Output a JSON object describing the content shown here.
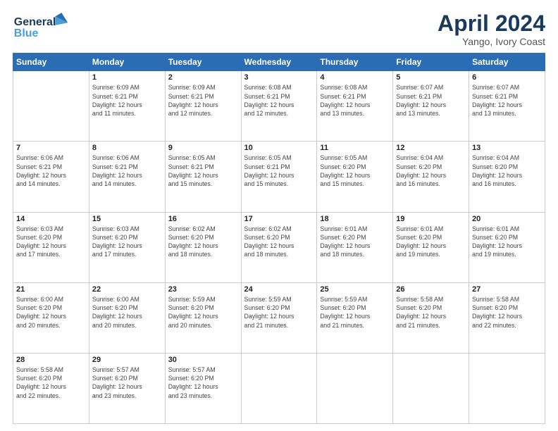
{
  "header": {
    "logo_line1": "General",
    "logo_line2": "Blue",
    "month": "April 2024",
    "location": "Yango, Ivory Coast"
  },
  "weekdays": [
    "Sunday",
    "Monday",
    "Tuesday",
    "Wednesday",
    "Thursday",
    "Friday",
    "Saturday"
  ],
  "weeks": [
    [
      {
        "day": "",
        "info": ""
      },
      {
        "day": "1",
        "info": "Sunrise: 6:09 AM\nSunset: 6:21 PM\nDaylight: 12 hours\nand 11 minutes."
      },
      {
        "day": "2",
        "info": "Sunrise: 6:09 AM\nSunset: 6:21 PM\nDaylight: 12 hours\nand 12 minutes."
      },
      {
        "day": "3",
        "info": "Sunrise: 6:08 AM\nSunset: 6:21 PM\nDaylight: 12 hours\nand 12 minutes."
      },
      {
        "day": "4",
        "info": "Sunrise: 6:08 AM\nSunset: 6:21 PM\nDaylight: 12 hours\nand 13 minutes."
      },
      {
        "day": "5",
        "info": "Sunrise: 6:07 AM\nSunset: 6:21 PM\nDaylight: 12 hours\nand 13 minutes."
      },
      {
        "day": "6",
        "info": "Sunrise: 6:07 AM\nSunset: 6:21 PM\nDaylight: 12 hours\nand 13 minutes."
      }
    ],
    [
      {
        "day": "7",
        "info": "Sunrise: 6:06 AM\nSunset: 6:21 PM\nDaylight: 12 hours\nand 14 minutes."
      },
      {
        "day": "8",
        "info": "Sunrise: 6:06 AM\nSunset: 6:21 PM\nDaylight: 12 hours\nand 14 minutes."
      },
      {
        "day": "9",
        "info": "Sunrise: 6:05 AM\nSunset: 6:21 PM\nDaylight: 12 hours\nand 15 minutes."
      },
      {
        "day": "10",
        "info": "Sunrise: 6:05 AM\nSunset: 6:21 PM\nDaylight: 12 hours\nand 15 minutes."
      },
      {
        "day": "11",
        "info": "Sunrise: 6:05 AM\nSunset: 6:20 PM\nDaylight: 12 hours\nand 15 minutes."
      },
      {
        "day": "12",
        "info": "Sunrise: 6:04 AM\nSunset: 6:20 PM\nDaylight: 12 hours\nand 16 minutes."
      },
      {
        "day": "13",
        "info": "Sunrise: 6:04 AM\nSunset: 6:20 PM\nDaylight: 12 hours\nand 16 minutes."
      }
    ],
    [
      {
        "day": "14",
        "info": "Sunrise: 6:03 AM\nSunset: 6:20 PM\nDaylight: 12 hours\nand 17 minutes."
      },
      {
        "day": "15",
        "info": "Sunrise: 6:03 AM\nSunset: 6:20 PM\nDaylight: 12 hours\nand 17 minutes."
      },
      {
        "day": "16",
        "info": "Sunrise: 6:02 AM\nSunset: 6:20 PM\nDaylight: 12 hours\nand 18 minutes."
      },
      {
        "day": "17",
        "info": "Sunrise: 6:02 AM\nSunset: 6:20 PM\nDaylight: 12 hours\nand 18 minutes."
      },
      {
        "day": "18",
        "info": "Sunrise: 6:01 AM\nSunset: 6:20 PM\nDaylight: 12 hours\nand 18 minutes."
      },
      {
        "day": "19",
        "info": "Sunrise: 6:01 AM\nSunset: 6:20 PM\nDaylight: 12 hours\nand 19 minutes."
      },
      {
        "day": "20",
        "info": "Sunrise: 6:01 AM\nSunset: 6:20 PM\nDaylight: 12 hours\nand 19 minutes."
      }
    ],
    [
      {
        "day": "21",
        "info": "Sunrise: 6:00 AM\nSunset: 6:20 PM\nDaylight: 12 hours\nand 20 minutes."
      },
      {
        "day": "22",
        "info": "Sunrise: 6:00 AM\nSunset: 6:20 PM\nDaylight: 12 hours\nand 20 minutes."
      },
      {
        "day": "23",
        "info": "Sunrise: 5:59 AM\nSunset: 6:20 PM\nDaylight: 12 hours\nand 20 minutes."
      },
      {
        "day": "24",
        "info": "Sunrise: 5:59 AM\nSunset: 6:20 PM\nDaylight: 12 hours\nand 21 minutes."
      },
      {
        "day": "25",
        "info": "Sunrise: 5:59 AM\nSunset: 6:20 PM\nDaylight: 12 hours\nand 21 minutes."
      },
      {
        "day": "26",
        "info": "Sunrise: 5:58 AM\nSunset: 6:20 PM\nDaylight: 12 hours\nand 21 minutes."
      },
      {
        "day": "27",
        "info": "Sunrise: 5:58 AM\nSunset: 6:20 PM\nDaylight: 12 hours\nand 22 minutes."
      }
    ],
    [
      {
        "day": "28",
        "info": "Sunrise: 5:58 AM\nSunset: 6:20 PM\nDaylight: 12 hours\nand 22 minutes."
      },
      {
        "day": "29",
        "info": "Sunrise: 5:57 AM\nSunset: 6:20 PM\nDaylight: 12 hours\nand 23 minutes."
      },
      {
        "day": "30",
        "info": "Sunrise: 5:57 AM\nSunset: 6:20 PM\nDaylight: 12 hours\nand 23 minutes."
      },
      {
        "day": "",
        "info": ""
      },
      {
        "day": "",
        "info": ""
      },
      {
        "day": "",
        "info": ""
      },
      {
        "day": "",
        "info": ""
      }
    ]
  ]
}
